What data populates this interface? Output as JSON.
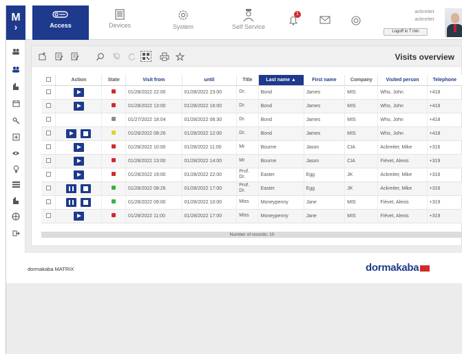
{
  "logo": {
    "letter": "M",
    "chevron": "›"
  },
  "nav": [
    {
      "label": "Access",
      "icon": "key-icon",
      "active": true
    },
    {
      "label": "Devices",
      "icon": "device-icon",
      "active": false
    },
    {
      "label": "System",
      "icon": "gear-icon",
      "active": false
    },
    {
      "label": "Self Service",
      "icon": "person-icon",
      "active": false
    }
  ],
  "header": {
    "notification_count": "1",
    "user_line1": "ackreiter",
    "user_line2": "ackreiter",
    "logoff_label": "Logoff in 7 min"
  },
  "sidebar_icons": [
    "users-icon",
    "users-group-icon",
    "door-icon",
    "calendar-icon",
    "key-icon",
    "plus-square-icon",
    "eye-icon",
    "bulb-icon",
    "list-icon",
    "building-icon",
    "globe-icon",
    "logout-icon"
  ],
  "toolbar": {
    "icons": [
      "add-icon",
      "edit-icon",
      "edit-list-icon",
      "search-icon",
      "clear-filter-icon",
      "refresh-icon",
      "qr-code-icon",
      "print-icon",
      "star-icon"
    ],
    "title": "Visits overview"
  },
  "table": {
    "headers": [
      "",
      "Action",
      "State",
      "Visit from",
      "until",
      "Title",
      "Last name ▲",
      "First name",
      "Company",
      "Visited person",
      "Telephone"
    ],
    "rows": [
      {
        "actions": [
          "play"
        ],
        "state": "#d32a2a",
        "from": "01/28/2022 22:00",
        "until": "01/28/2022 23:00",
        "title": "Dr.",
        "last": "Bond",
        "first": "James",
        "company": "MIS",
        "person": "Who, John",
        "phone": "+418"
      },
      {
        "actions": [
          "play"
        ],
        "state": "#d32a2a",
        "from": "01/28/2022 13:00",
        "until": "01/28/2022 16:00",
        "title": "Dr.",
        "last": "Bond",
        "first": "James",
        "company": "MIS",
        "person": "Who, John",
        "phone": "+418"
      },
      {
        "actions": [],
        "state": "#8a8a8a",
        "from": "01/27/2022 18:04",
        "until": "01/28/2022 06:30",
        "title": "Dr.",
        "last": "Bond",
        "first": "James",
        "company": "MIS",
        "person": "Who, John",
        "phone": "+418"
      },
      {
        "actions": [
          "play",
          "stop"
        ],
        "state": "#e3d21f",
        "from": "01/28/2022 08:26",
        "until": "01/28/2022 12:00",
        "title": "Dr.",
        "last": "Bond",
        "first": "James",
        "company": "MIS",
        "person": "Who, John",
        "phone": "+418"
      },
      {
        "actions": [
          "play"
        ],
        "state": "#d32a2a",
        "from": "01/28/2022 10:00",
        "until": "01/28/2022 11:00",
        "title": "Mr",
        "last": "Bourne",
        "first": "Jason",
        "company": "CIA",
        "person": "Ackreiter, Mike",
        "phone": "+316"
      },
      {
        "actions": [
          "play"
        ],
        "state": "#d32a2a",
        "from": "01/28/2022 13:00",
        "until": "01/28/2022 14:00",
        "title": "Mr",
        "last": "Bourne",
        "first": "Jason",
        "company": "CIA",
        "person": "Fiévet, Alexis",
        "phone": "+319"
      },
      {
        "actions": [
          "play"
        ],
        "state": "#d32a2a",
        "from": "01/28/2022 19:00",
        "until": "01/28/2022 22:00",
        "title": "Prof. Dr.",
        "last": "Easter",
        "first": "Egg",
        "company": "JK",
        "person": "Ackreiter, Mike",
        "phone": "+316"
      },
      {
        "actions": [
          "pause",
          "stop"
        ],
        "state": "#3fae3f",
        "from": "01/28/2022 08:26",
        "until": "01/28/2022 17:00",
        "title": "Prof. Dr.",
        "last": "Easter",
        "first": "Egg",
        "company": "JK",
        "person": "Ackreiter, Mike",
        "phone": "+316"
      },
      {
        "actions": [
          "pause",
          "stop"
        ],
        "state": "#3fae3f",
        "from": "01/28/2022 09:00",
        "until": "01/28/2022 10:00",
        "title": "Miss",
        "last": "Moneypenny",
        "first": "Jane",
        "company": "MIS",
        "person": "Fiévet, Alexis",
        "phone": "+319"
      },
      {
        "actions": [
          "play"
        ],
        "state": "#d32a2a",
        "from": "01/28/2022 11:00",
        "until": "01/28/2022 17:00",
        "title": "Miss",
        "last": "Moneypenny",
        "first": "Jane",
        "company": "MIS",
        "person": "Fiévet, Alexis",
        "phone": "+319"
      }
    ],
    "footer": "Number of records: 10"
  },
  "brand": {
    "left": "dormakaba MATRIX",
    "right": "dormakaba"
  }
}
